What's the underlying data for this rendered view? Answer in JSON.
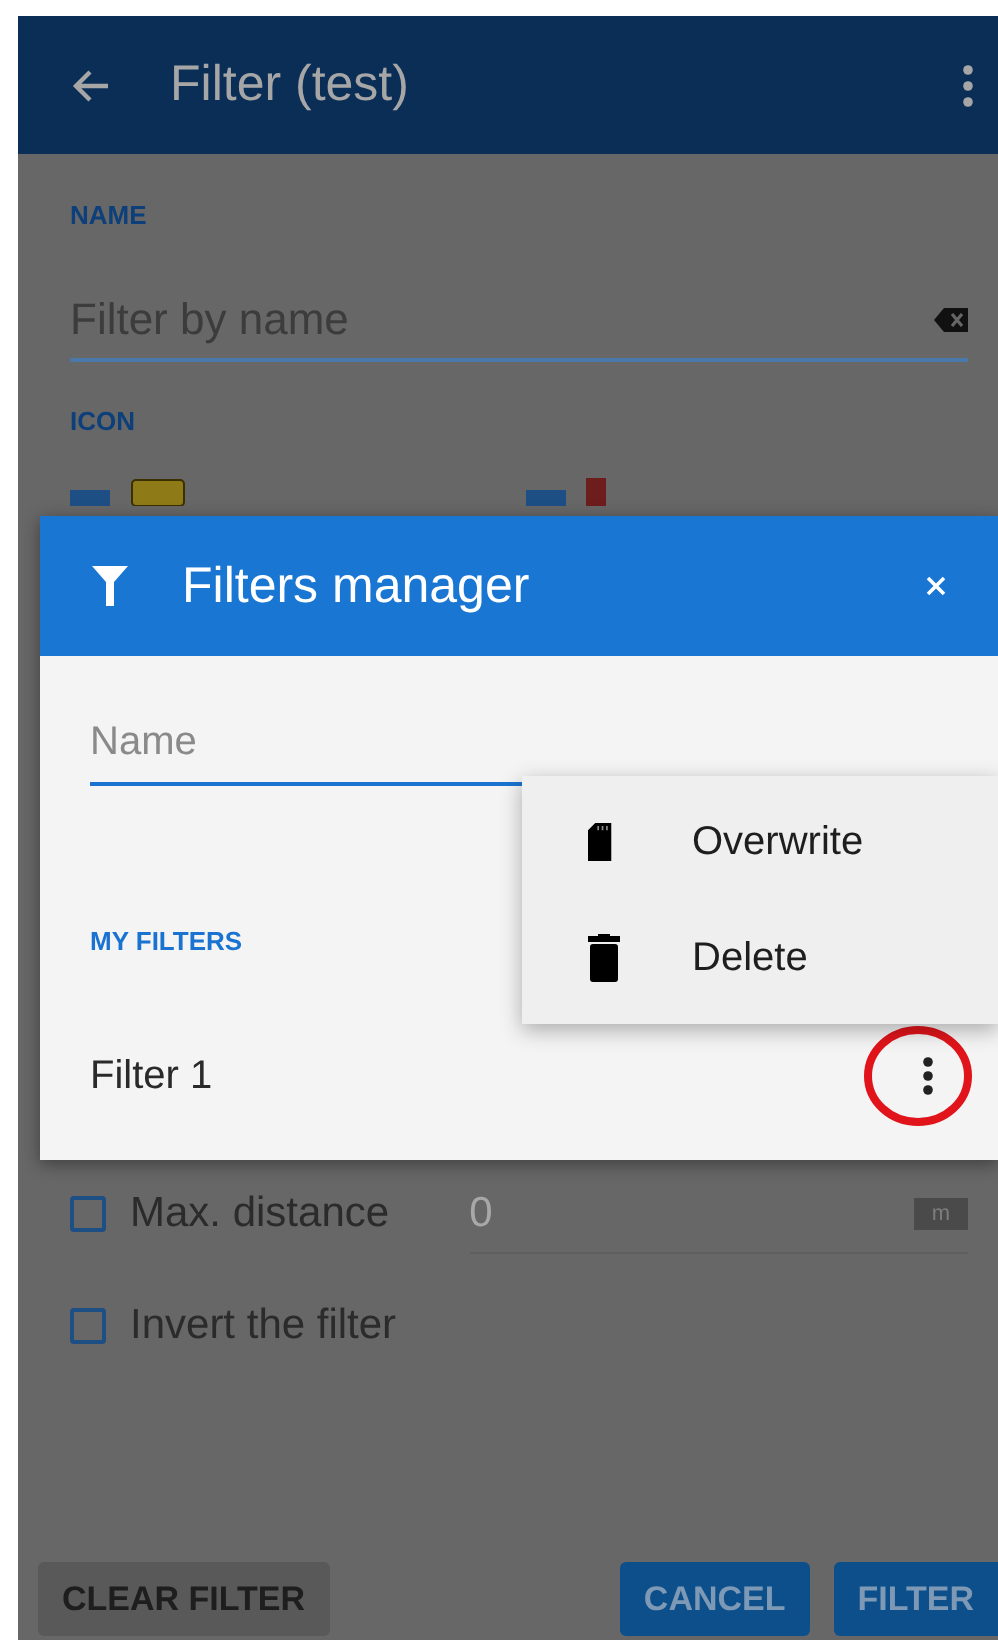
{
  "app_bar": {
    "title": "Filter (test)"
  },
  "name_section": {
    "label": "NAME",
    "field": {
      "placeholder": "Filter by name"
    }
  },
  "icon_section": {
    "label": "ICON"
  },
  "options": [
    {
      "kind": "distance",
      "label": "Max. distance",
      "checked": false,
      "value": "0",
      "unit": "m"
    },
    {
      "kind": "checkbox",
      "label": "Invert the filter",
      "checked": false
    }
  ],
  "buttons": [
    {
      "label": "CLEAR FILTER",
      "kind": "secondary"
    },
    {
      "label": "CANCEL",
      "kind": "primary"
    },
    {
      "label": "FILTER",
      "kind": "primary"
    }
  ],
  "dialog": {
    "title": "Filters manager",
    "name_field": {
      "placeholder": "Name"
    },
    "section_label": "MY FILTERS",
    "filters": [
      {
        "name": "Filter 1",
        "circled": true
      }
    ]
  },
  "context_menu": {
    "items": [
      {
        "label": "Overwrite",
        "kind": "sd-card"
      },
      {
        "label": "Delete",
        "kind": "trash"
      }
    ]
  }
}
